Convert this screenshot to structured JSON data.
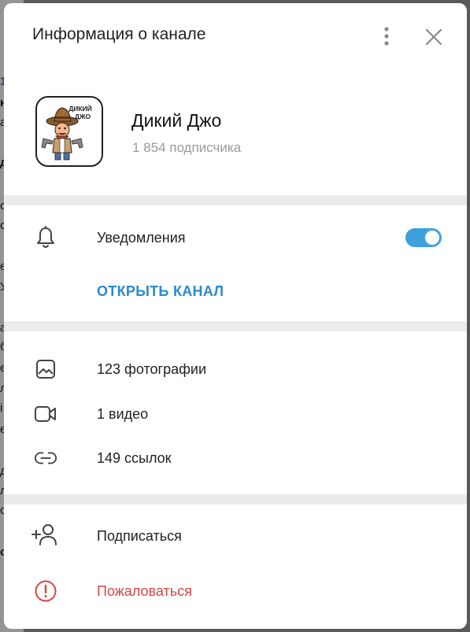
{
  "dialog": {
    "title": "Информация о канале",
    "more_icon": "more-vertical-icon",
    "close_icon": "close-icon"
  },
  "channel": {
    "name": "Дикий Джо",
    "subscribers": "1 854 подписчика",
    "avatar_caption_line1": "ДИКИЙ",
    "avatar_caption_line2": "ДЖО"
  },
  "notifications": {
    "label": "Уведомления",
    "icon": "bell-icon",
    "enabled": true
  },
  "open_channel": {
    "label": "ОТКРЫТЬ КАНАЛ"
  },
  "media": {
    "photos": {
      "label": "123 фотографии",
      "icon": "image-icon"
    },
    "videos": {
      "label": "1 видео",
      "icon": "video-icon"
    },
    "links": {
      "label": "149 ссылок",
      "icon": "link-icon"
    }
  },
  "actions": {
    "subscribe": {
      "label": "Подписаться",
      "icon": "add-user-icon"
    },
    "report": {
      "label": "Пожаловаться",
      "icon": "alert-icon"
    }
  },
  "colors": {
    "accent": "#3d9fdc",
    "link": "#2b8acb",
    "danger": "#d64545",
    "muted": "#9a9a9a"
  }
}
